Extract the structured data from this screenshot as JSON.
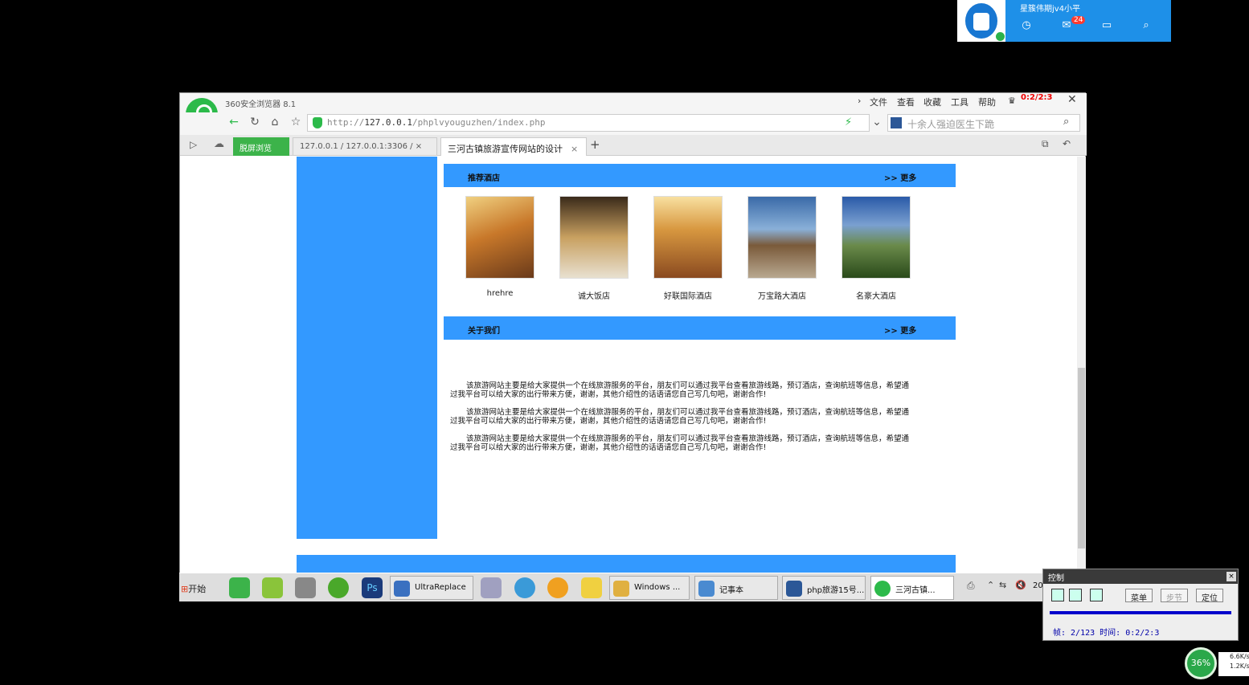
{
  "qq": {
    "name": "星簇伟期jv4小平",
    "badge": "24"
  },
  "browser": {
    "title": "360安全浏览器 8.1",
    "menu": [
      "文件",
      "查看",
      "收藏",
      "工具",
      "帮助"
    ],
    "timer": "0:2/2:3",
    "url_prefix": "http://",
    "url_host": "127.0.0.1",
    "url_path": "/phplvyouguzhen/index.php",
    "search_placeholder": "十余人强迫医生下跪",
    "tabs": [
      {
        "label": "脱屏浏览"
      },
      {
        "label": "127.0.0.1 / 127.0.0.1:3306 / ×"
      },
      {
        "label": "三河古镇旅游宣传网站的设计"
      }
    ]
  },
  "page": {
    "hotel_section": {
      "title": "推荐酒店",
      "more": ">> 更多"
    },
    "hotels": [
      {
        "name": "hrehre",
        "color": "#c8782a"
      },
      {
        "name": "诚大饭店",
        "color": "#8a6a3a"
      },
      {
        "name": "好联国际酒店",
        "color": "#c89040"
      },
      {
        "name": "万宝路大酒店",
        "color": "#5c84b8"
      },
      {
        "name": "名豪大酒店",
        "color": "#4a7a3a"
      }
    ],
    "about_section": {
      "title": "关于我们",
      "more": ">> 更多"
    },
    "about_paras": [
      "该旅游网站主要是给大家提供一个在线旅游服务的平台，朋友们可以通过我平台查看旅游线路，预订酒店，查询航班等信息，希望通过我平台可以给大家的出行带来方便，谢谢，其他介绍性的话语请您自己写几句吧，谢谢合作!",
      "该旅游网站主要是给大家提供一个在线旅游服务的平台，朋友们可以通过我平台查看旅游线路，预订酒店，查询航班等信息，希望通过我平台可以给大家的出行带来方便，谢谢，其他介绍性的话语请您自己写几句吧，谢谢合作!",
      "该旅游网站主要是给大家提供一个在线旅游服务的平台，朋友们可以通过我平台查看旅游线路，预订酒店，查询航班等信息，希望通过我平台可以给大家的出行带来方便，谢谢，其他介绍性的话语请您自己写几句吧，谢谢合作!"
    ]
  },
  "taskbar": {
    "start": "开始",
    "items": [
      {
        "label": "UltraReplace",
        "color": "#3a70c0"
      },
      {
        "label": "Windows ...",
        "color": "#e0b040"
      },
      {
        "label": "记事本",
        "color": "#4a8ad0"
      },
      {
        "label": "php旅游15号...",
        "color": "#2b5797"
      },
      {
        "label": "三河古镇...",
        "color": "#2cba4a"
      }
    ],
    "clock": "20"
  },
  "control": {
    "title": "控制",
    "menu_btn": "菜单",
    "step_btn": "步节",
    "locate_btn": "定位",
    "info": "帧: 2/123 时间: 0:2/2:3"
  },
  "gauge": "36%",
  "net": {
    "up": "6.6K/s",
    "down": "1.2K/s"
  }
}
